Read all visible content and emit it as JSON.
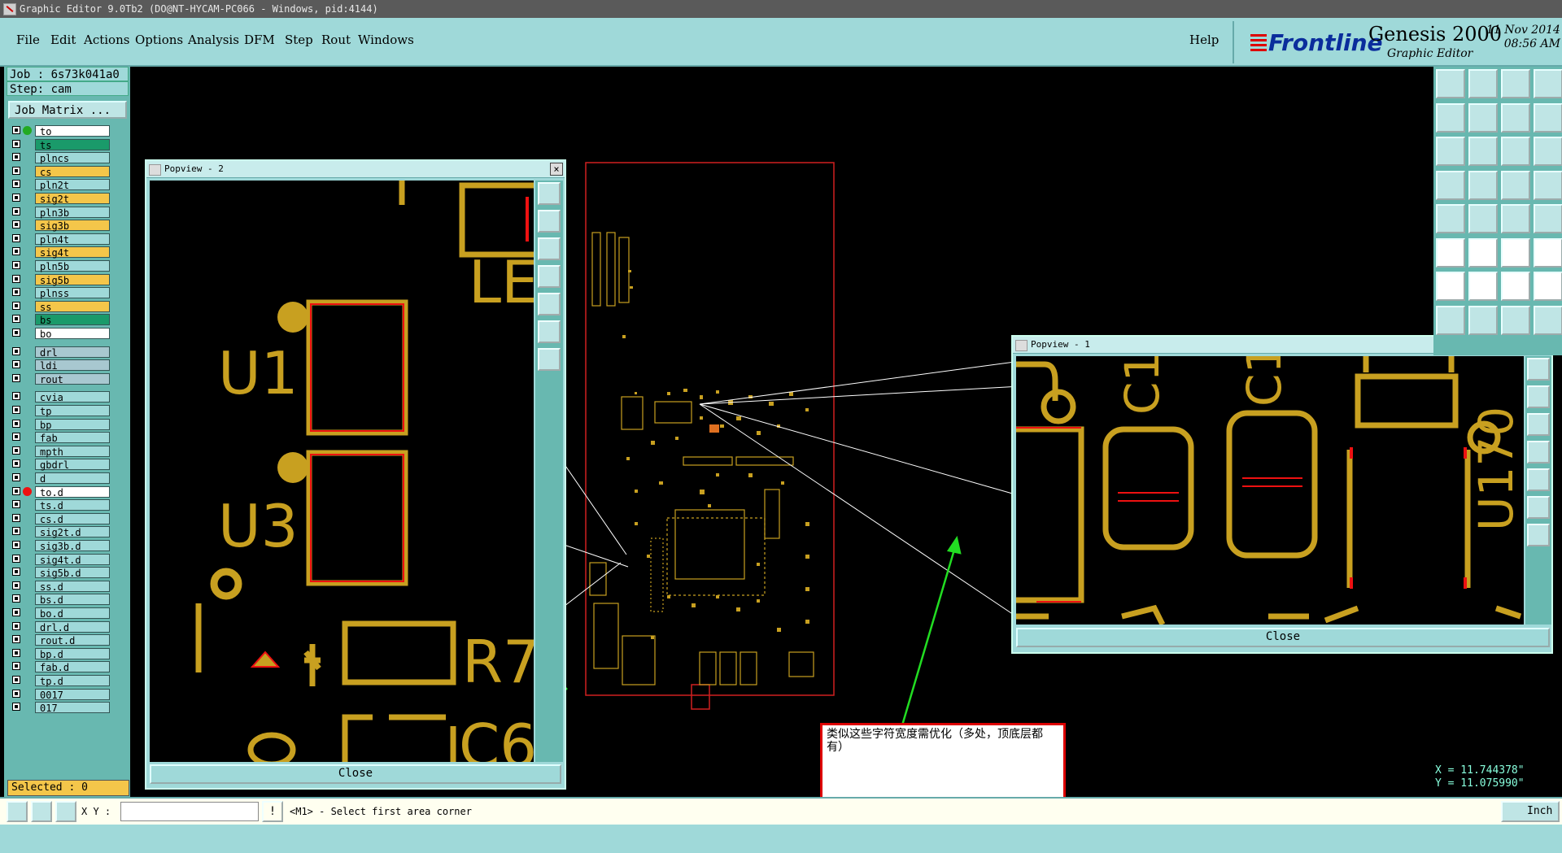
{
  "window": {
    "title": "Graphic Editor 9.0Tb2 (DO@NT-HYCAM-PC066 - Windows, pid:4144)"
  },
  "menu": [
    "File",
    "Edit",
    "Actions",
    "Options",
    "Analysis",
    "DFM",
    "Step",
    "Rout",
    "Windows"
  ],
  "help": "Help",
  "brand": {
    "logo": "Frontline",
    "product": "Genesis 2000",
    "subtitle": "Graphic Editor",
    "date": "11 Nov 2014",
    "time": "08:56 AM"
  },
  "job": {
    "job_line": "Job : 6s73k041a0",
    "step_line": "Step: cam",
    "matrix_button": "Job Matrix ..."
  },
  "layers": [
    {
      "name": "to",
      "color": "#ffffff",
      "dot": "#22aa22"
    },
    {
      "name": "ts",
      "color": "#1a9a6a",
      "dot": ""
    },
    {
      "name": "plncs",
      "color": "#9fd9d9",
      "dot": ""
    },
    {
      "name": "cs",
      "color": "#f4c64a",
      "dot": ""
    },
    {
      "name": "pln2t",
      "color": "#9fd9d9",
      "dot": ""
    },
    {
      "name": "sig2t",
      "color": "#f4c64a",
      "dot": ""
    },
    {
      "name": "pln3b",
      "color": "#9fd9d9",
      "dot": ""
    },
    {
      "name": "sig3b",
      "color": "#f4c64a",
      "dot": ""
    },
    {
      "name": "pln4t",
      "color": "#9fd9d9",
      "dot": ""
    },
    {
      "name": "sig4t",
      "color": "#f4c64a",
      "dot": ""
    },
    {
      "name": "pln5b",
      "color": "#9fd9d9",
      "dot": ""
    },
    {
      "name": "sig5b",
      "color": "#f4c64a",
      "dot": ""
    },
    {
      "name": "plnss",
      "color": "#9fd9d9",
      "dot": ""
    },
    {
      "name": "ss",
      "color": "#f4c64a",
      "dot": ""
    },
    {
      "name": "bs",
      "color": "#1a9a6a",
      "dot": ""
    },
    {
      "name": "bo",
      "color": "#ffffff",
      "dot": ""
    },
    {
      "name": "drl",
      "color": "#a8c8d0",
      "dot": ""
    },
    {
      "name": "ldi",
      "color": "#a8c8d0",
      "dot": ""
    },
    {
      "name": "rout",
      "color": "#a8c8d0",
      "dot": ""
    },
    {
      "name": "cvia",
      "color": "#9fd9d9",
      "dot": ""
    },
    {
      "name": "tp",
      "color": "#9fd9d9",
      "dot": ""
    },
    {
      "name": "bp",
      "color": "#9fd9d9",
      "dot": ""
    },
    {
      "name": "fab",
      "color": "#9fd9d9",
      "dot": ""
    },
    {
      "name": "mpth",
      "color": "#9fd9d9",
      "dot": ""
    },
    {
      "name": "gbdrl",
      "color": "#9fd9d9",
      "dot": ""
    },
    {
      "name": "d",
      "color": "#9fd9d9",
      "dot": ""
    },
    {
      "name": "to.d",
      "color": "#ffffff",
      "dot": "#ee1111"
    },
    {
      "name": "ts.d",
      "color": "#9fd9d9",
      "dot": ""
    },
    {
      "name": "cs.d",
      "color": "#9fd9d9",
      "dot": ""
    },
    {
      "name": "sig2t.d",
      "color": "#9fd9d9",
      "dot": ""
    },
    {
      "name": "sig3b.d",
      "color": "#9fd9d9",
      "dot": ""
    },
    {
      "name": "sig4t.d",
      "color": "#9fd9d9",
      "dot": ""
    },
    {
      "name": "sig5b.d",
      "color": "#9fd9d9",
      "dot": ""
    },
    {
      "name": "ss.d",
      "color": "#9fd9d9",
      "dot": ""
    },
    {
      "name": "bs.d",
      "color": "#9fd9d9",
      "dot": ""
    },
    {
      "name": "bo.d",
      "color": "#9fd9d9",
      "dot": ""
    },
    {
      "name": "drl.d",
      "color": "#9fd9d9",
      "dot": ""
    },
    {
      "name": "rout.d",
      "color": "#9fd9d9",
      "dot": ""
    },
    {
      "name": "bp.d",
      "color": "#9fd9d9",
      "dot": ""
    },
    {
      "name": "fab.d",
      "color": "#9fd9d9",
      "dot": ""
    },
    {
      "name": "tp.d",
      "color": "#9fd9d9",
      "dot": ""
    },
    {
      "name": "0017",
      "color": "#9fd9d9",
      "dot": ""
    },
    {
      "name": "017",
      "color": "#9fd9d9",
      "dot": ""
    }
  ],
  "selected": "Selected : 0",
  "popview2": {
    "title": "Popview - 2",
    "close": "Close",
    "labels": [
      "LE",
      "U1",
      "U3",
      "R7",
      "C6"
    ]
  },
  "popview1": {
    "title": "Popview - 1",
    "close": "Close",
    "labels": [
      "C1",
      "C1",
      "U170"
    ]
  },
  "coords": {
    "x": "X = 11.744378\"",
    "y": "Y = 11.075990\""
  },
  "status": {
    "xy_label": "X Y :",
    "xy_value": "",
    "prompt": "<M1> - Select first area corner",
    "unit": "Inch"
  },
  "note": "类似这些字符宽度需优化（多处，顶底层都有）",
  "colors": {
    "copper": "#c8a020",
    "accent": "#ee1111",
    "arrow": "#22dd22"
  }
}
